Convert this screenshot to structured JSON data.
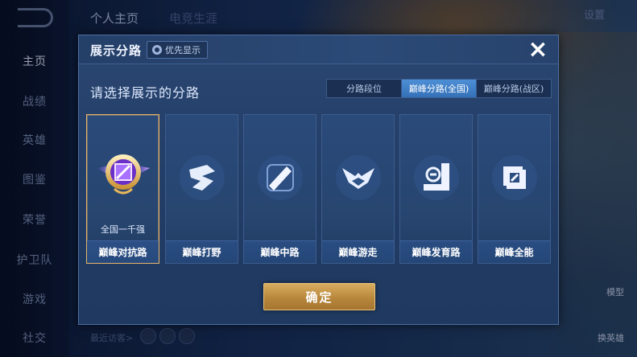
{
  "background": {
    "nav_items": [
      "主页",
      "战绩",
      "英雄",
      "图鉴",
      "荣誉",
      "护卫队",
      "游戏",
      "社交"
    ],
    "top_tabs": [
      "个人主页",
      "电竞生涯"
    ],
    "settings_label": "设置",
    "recent_visitors": "最近访客>",
    "right_labels": [
      "模型",
      "换英雄"
    ]
  },
  "modal": {
    "title": "展示分路",
    "priority_button": "优先显示",
    "close_icon": "×",
    "subtitle": "请选择展示的分路",
    "segments": [
      {
        "label": "分路段位",
        "active": false
      },
      {
        "label": "巅峰分路(全国)",
        "active": true
      },
      {
        "label": "巅峰分路(战区)",
        "active": false
      }
    ],
    "cards": [
      {
        "label": "巅峰对抗路",
        "rank_text": "全国一千强",
        "icon": "gold-rank-badge-icon",
        "selected": true
      },
      {
        "label": "巅峰打野",
        "icon": "jungle-lane-icon",
        "selected": false
      },
      {
        "label": "巅峰中路",
        "icon": "mid-lane-icon",
        "selected": false
      },
      {
        "label": "巅峰游走",
        "icon": "roam-lane-icon",
        "selected": false
      },
      {
        "label": "巅峰发育路",
        "icon": "farm-lane-icon",
        "selected": false
      },
      {
        "label": "巅峰全能",
        "icon": "all-round-lane-icon",
        "selected": false
      }
    ],
    "confirm_button": "确定"
  },
  "colors": {
    "accent_gold": "#e9b46a",
    "segment_active": "#3f80c8",
    "modal_bg": "#243f68"
  }
}
